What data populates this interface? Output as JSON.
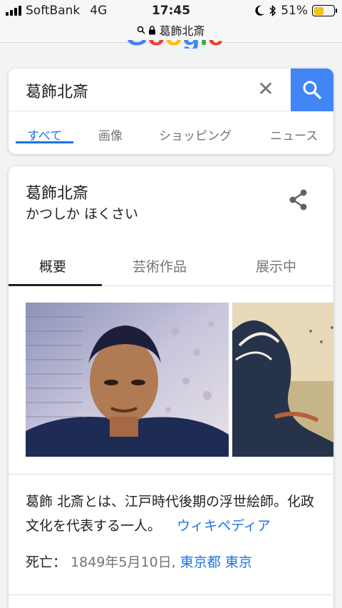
{
  "status_bar": {
    "carrier": "SoftBank",
    "network": "4G",
    "time": "17:45",
    "battery": "51%",
    "battery_level": 0.51,
    "url": "葛飾北斎"
  },
  "search": {
    "query": "葛飾北斎",
    "tabs": [
      {
        "label": "すべて",
        "active": true
      },
      {
        "label": "画像",
        "active": false
      },
      {
        "label": "ショッピング",
        "active": false
      },
      {
        "label": "ニュース",
        "active": false
      }
    ]
  },
  "knowledge_panel": {
    "title": "葛飾北斎",
    "subtitle": "かつしか ほくさい",
    "tabs": [
      {
        "label": "概要",
        "active": true
      },
      {
        "label": "芸術作品",
        "active": false
      },
      {
        "label": "展示中",
        "active": false
      }
    ],
    "description": "葛飾 北斎とは、江戸時代後期の浮世絵師。化政文化を代表する一人。",
    "source_link": "ウィキペディア",
    "death_label": "死亡：",
    "death_date": "1849年5月10日,",
    "death_place_1": "東京都",
    "death_place_2": "東京"
  },
  "colors": {
    "accent": "#1a73e8",
    "search_button": "#4285f4",
    "battery": "#f4c21c"
  }
}
